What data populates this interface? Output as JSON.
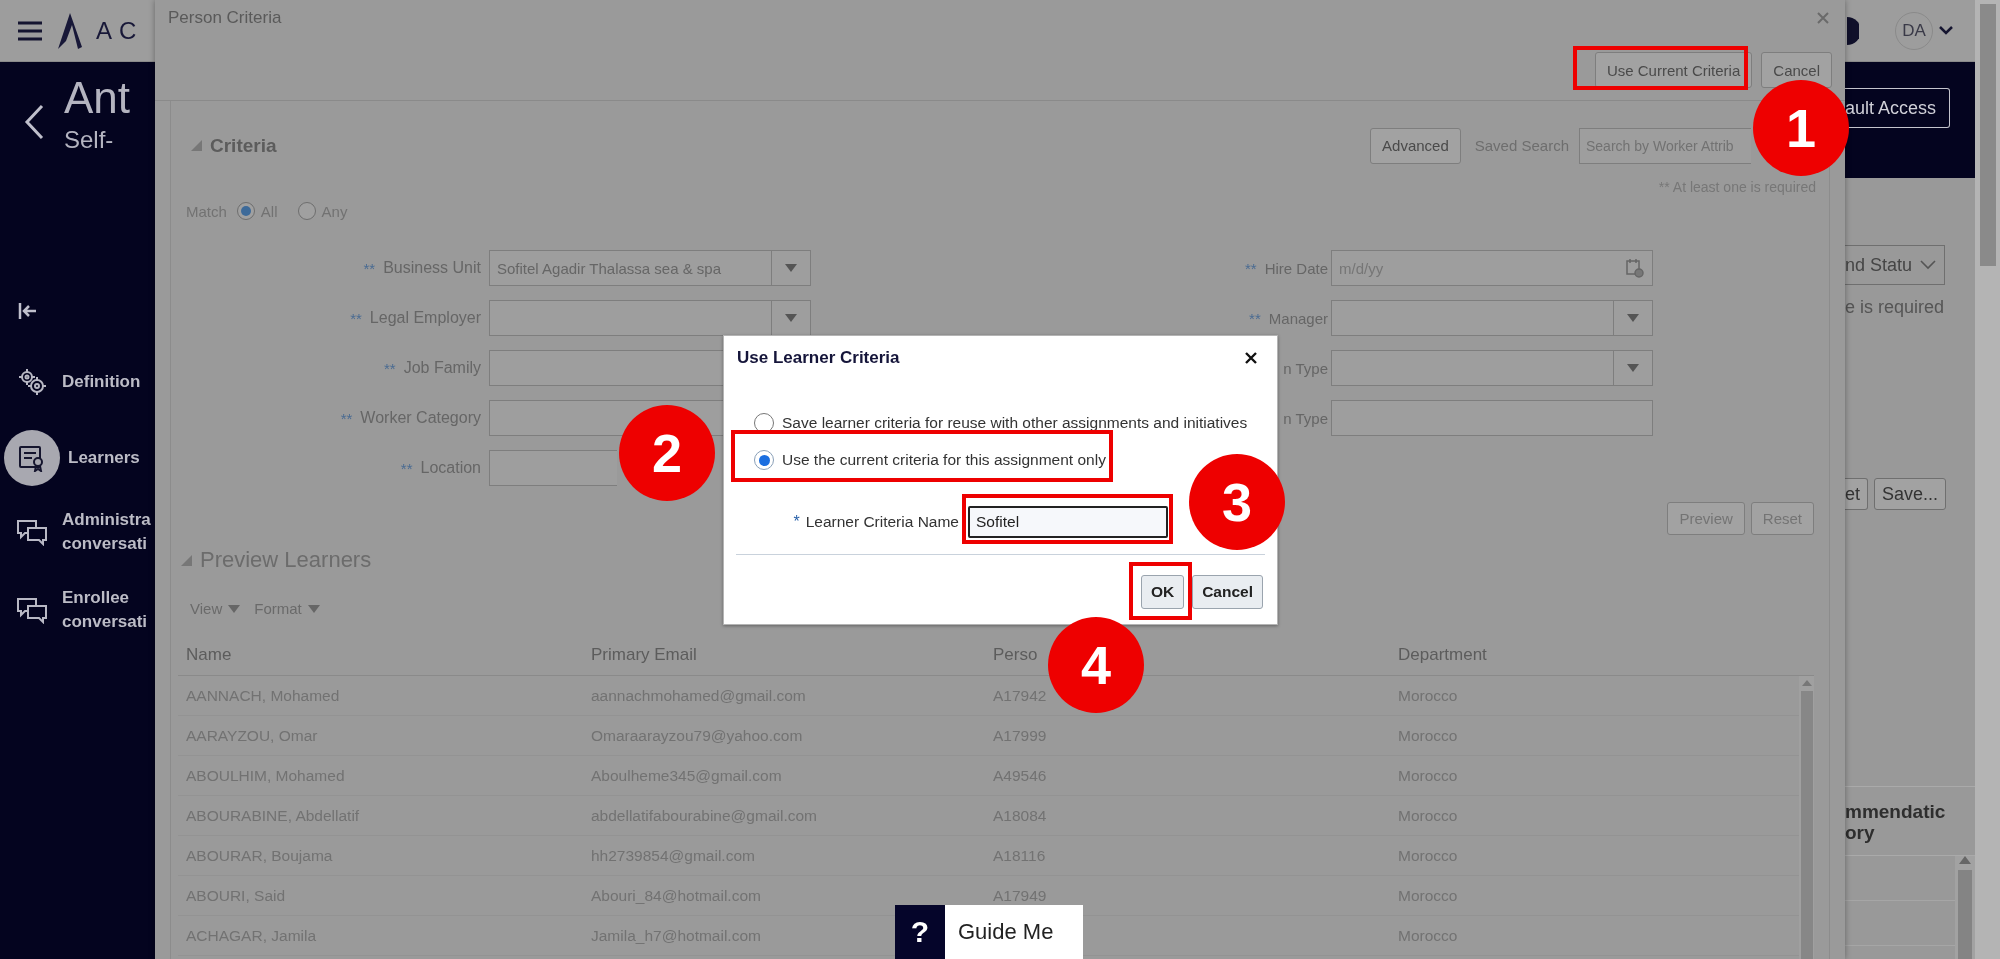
{
  "topbar": {
    "logo": "AC",
    "avatar": "DA"
  },
  "header": {
    "title": "Ant",
    "subtitle": "Self-",
    "action_button": "ault Access"
  },
  "sidebar": {
    "items": [
      {
        "kind": "gears",
        "lines": [
          "Definition"
        ],
        "selected": false
      },
      {
        "kind": "learner",
        "lines": [
          "Learners"
        ],
        "selected": true
      },
      {
        "kind": "chat",
        "lines": [
          "Administra",
          "conversati"
        ],
        "selected": false
      },
      {
        "kind": "chat",
        "lines": [
          "Enrollee",
          "conversati"
        ],
        "selected": false
      }
    ]
  },
  "page_right": {
    "select": "nd Statu",
    "note": "e is required",
    "buttons": [
      "et",
      "Save..."
    ],
    "column_heading": [
      "mmendatic",
      "ory"
    ]
  },
  "modal": {
    "title": "Person Criteria",
    "buttons": [
      "Use Current Criteria",
      "Cancel"
    ],
    "criteria": {
      "heading": "Criteria",
      "advanced_button": "Advanced",
      "saved_search_label": "Saved Search",
      "saved_search_placeholder": "Search by Worker Attrib",
      "required_note": "** At least one is required",
      "match": {
        "label": "Match",
        "options": [
          {
            "label": "All",
            "selected": true
          },
          {
            "label": "Any",
            "selected": false
          }
        ]
      },
      "left_fields": [
        {
          "mark": "**",
          "label": "Business Unit",
          "kind": "select",
          "value": "Sofitel Agadir Thalassa sea & spa"
        },
        {
          "mark": "**",
          "label": "Legal Employer",
          "kind": "select"
        },
        {
          "mark": "**",
          "label": "Job Family",
          "kind": "text"
        },
        {
          "mark": "**",
          "label": "Worker Category",
          "kind": "text"
        },
        {
          "mark": "**",
          "label": "Location",
          "kind": "text"
        }
      ],
      "right_fields": [
        {
          "mark": "**",
          "label": "Hire Date",
          "kind": "date",
          "placeholder": "m/d/yy"
        },
        {
          "mark": "**",
          "label": "Manager",
          "kind": "select"
        },
        {
          "label": "n Type",
          "kind": "select"
        },
        {
          "label": "n Type",
          "kind": "text"
        }
      ],
      "buttons": [
        "Preview",
        "Reset"
      ]
    },
    "preview": {
      "heading": "Preview Learners",
      "toolbar": [
        "View",
        "Format"
      ],
      "table": {
        "columns": [
          "Name",
          "Primary Email",
          "Perso",
          "Department"
        ],
        "rows": [
          {
            "name": "AANNACH, Mohamed",
            "email": "aannachmohamed@gmail.com",
            "person": "A17942",
            "department": "Morocco"
          },
          {
            "name": "AARAYZOU, Omar",
            "email": "Omaraarayzou79@yahoo.com",
            "person": "A17999",
            "department": "Morocco"
          },
          {
            "name": "ABOULHIM, Mohamed",
            "email": "Aboulheme345@gmail.com",
            "person": "A49546",
            "department": "Morocco"
          },
          {
            "name": "ABOURABINE, Abdellatif",
            "email": "abdellatifabourabine@gmail.com",
            "person": "A18084",
            "department": "Morocco"
          },
          {
            "name": "ABOURAR, Boujama",
            "email": "hh2739854@gmail.com",
            "person": "A18116",
            "department": "Morocco"
          },
          {
            "name": "ABOURI, Said",
            "email": "Abouri_84@hotmail.com",
            "person": "A17949",
            "department": "Morocco"
          },
          {
            "name": "ACHAGAR, Jamila",
            "email": "Jamila_h7@hotmail.com",
            "department": "Morocco"
          }
        ]
      }
    }
  },
  "dialog": {
    "title": "Use Learner Criteria",
    "options": [
      {
        "label": "Save learner criteria for reuse with other assignments and initiatives",
        "selected": false
      },
      {
        "label": "Use the current criteria for this assignment only",
        "selected": true
      }
    ],
    "name_field": {
      "mark": "*",
      "label": "Learner Criteria Name",
      "value": "Sofitel"
    },
    "buttons": [
      "OK",
      "Cancel"
    ]
  },
  "guide_me": {
    "icon": "?",
    "label": "Guide Me"
  },
  "callouts": [
    {
      "number": "1"
    },
    {
      "number": "2"
    },
    {
      "number": "3"
    },
    {
      "number": "4"
    }
  ]
}
